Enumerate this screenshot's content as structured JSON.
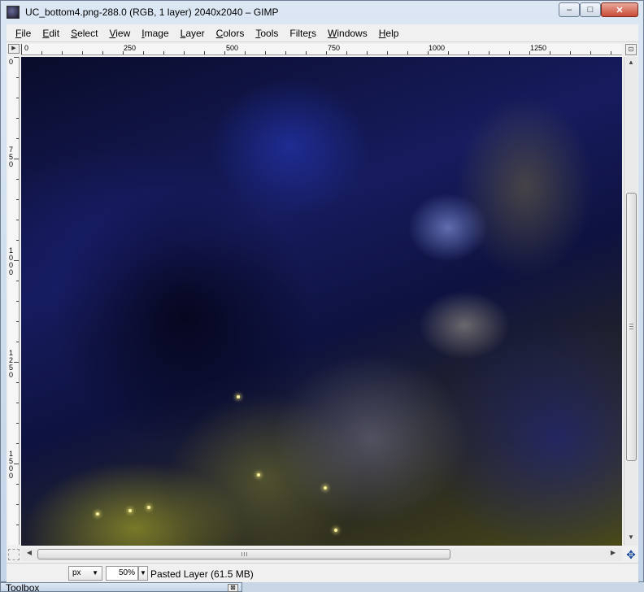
{
  "window": {
    "title": "UC_bottom4.png-288.0 (RGB, 1 layer) 2040x2040 – GIMP",
    "buttons": {
      "minimize": "–",
      "maximize": "□",
      "close": "✕"
    }
  },
  "menubar": {
    "items": [
      {
        "u": "F",
        "rest": "ile"
      },
      {
        "u": "E",
        "rest": "dit"
      },
      {
        "u": "S",
        "rest": "elect"
      },
      {
        "u": "V",
        "rest": "iew"
      },
      {
        "u": "I",
        "rest": "mage"
      },
      {
        "u": "L",
        "rest": "ayer"
      },
      {
        "u": "C",
        "rest": "olors"
      },
      {
        "u": "T",
        "rest": "ools"
      },
      {
        "pre": "Filte",
        "u": "r",
        "rest": "s"
      },
      {
        "u": "W",
        "rest": "indows"
      },
      {
        "u": "H",
        "rest": "elp"
      }
    ]
  },
  "rulers": {
    "horizontal_labels": [
      "0",
      "250",
      "500",
      "750",
      "1000",
      "1250"
    ],
    "vertical_labels": [
      "0",
      "750",
      "1000",
      "1250",
      "1500"
    ]
  },
  "icons": {
    "nav_toggle": "menu-arrow-icon",
    "zoom": "zoom-icon",
    "navigate": "navigate-icon",
    "quick_mask": "quick-mask-icon"
  },
  "statusbar": {
    "unit": "px",
    "zoom": "50%",
    "layer_info": "Pasted Layer (61.5 MB)"
  },
  "toolbox": {
    "title": "Toolbox",
    "close": "⊠"
  },
  "colors": {
    "title_close_button": "#c94a35",
    "nebula_blue": "#161c5e",
    "nebula_yellow": "#4a4a18"
  }
}
